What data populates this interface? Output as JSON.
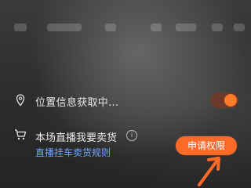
{
  "location": {
    "label": "位置信息获取中..."
  },
  "sell": {
    "title": "本场直播我要卖货",
    "info_icon": "info-icon",
    "link_text": "直播挂车卖货规则",
    "apply_button": "申请权限"
  },
  "colors": {
    "accent": "#ff6b27",
    "link": "#6fa8ff"
  },
  "icons": [
    "location-pin-icon",
    "shopping-cart-icon",
    "info-icon",
    "arrow-pointer-icon"
  ]
}
